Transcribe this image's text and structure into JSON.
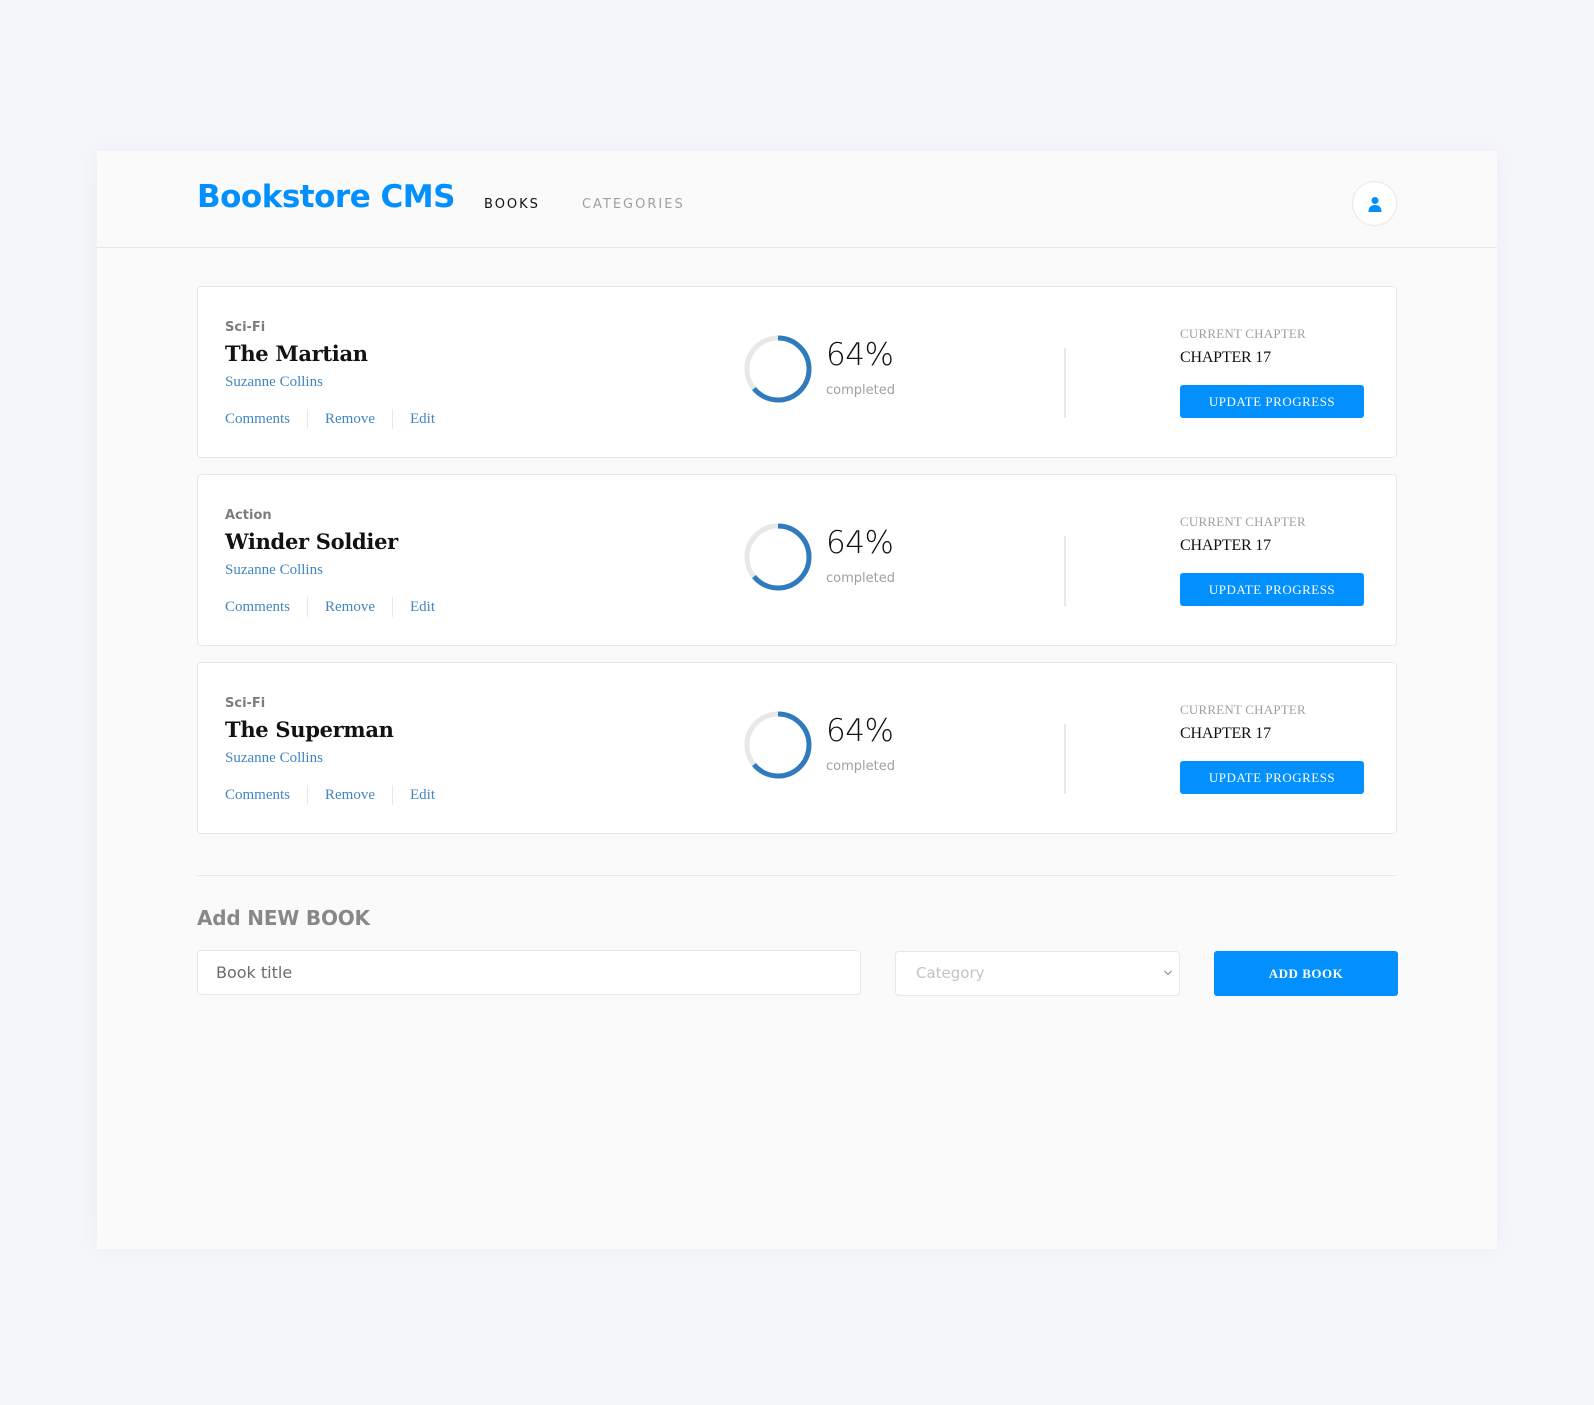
{
  "header": {
    "logo": "Bookstore CMS",
    "nav": [
      {
        "label": "BOOKS",
        "active": true
      },
      {
        "label": "CATEGORIES",
        "active": false
      }
    ],
    "user_icon": "user-icon"
  },
  "books": [
    {
      "genre": "Sci-Fi",
      "title": "The Martian",
      "author": "Suzanne Collins",
      "actions": [
        "Comments",
        "Remove",
        "Edit"
      ],
      "progress": 0.64,
      "percent_label": "64%",
      "completed_label": "completed",
      "current_chapter_label": "CURRENT CHAPTER",
      "chapter": "CHAPTER 17",
      "update_label": "UPDATE PROGRESS"
    },
    {
      "genre": "Action",
      "title": "Winder Soldier",
      "author": "Suzanne Collins",
      "actions": [
        "Comments",
        "Remove",
        "Edit"
      ],
      "progress": 0.64,
      "percent_label": "64%",
      "completed_label": "completed",
      "current_chapter_label": "CURRENT CHAPTER",
      "chapter": "CHAPTER 17",
      "update_label": "UPDATE PROGRESS"
    },
    {
      "genre": "Sci-Fi",
      "title": "The Superman",
      "author": "Suzanne Collins",
      "actions": [
        "Comments",
        "Remove",
        "Edit"
      ],
      "progress": 0.64,
      "percent_label": "64%",
      "completed_label": "completed",
      "current_chapter_label": "CURRENT CHAPTER",
      "chapter": "CHAPTER 17",
      "update_label": "UPDATE PROGRESS"
    }
  ],
  "form": {
    "title": "Add NEW BOOK",
    "book_title_placeholder": "Book title",
    "category_placeholder": "Category",
    "submit_label": "ADD BOOK"
  },
  "colors": {
    "accent": "#0290ff",
    "link": "#4386bf",
    "progress_track": "#e8e8e8",
    "progress_fill": "#307bbe"
  }
}
